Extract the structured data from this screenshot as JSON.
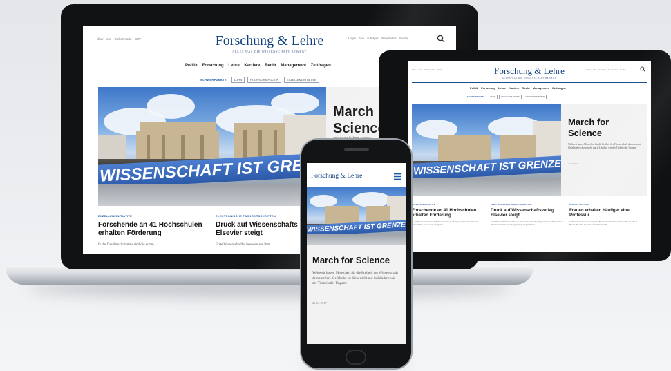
{
  "site": {
    "brand": "Forschung & Lehre",
    "tagline": "ALLES WAS DIE WISSENSCHAFT BEWEGT",
    "left_links": [
      "Über uns",
      "Stellenmarkt",
      "DHV"
    ],
    "right_links": [
      "Login",
      "Abo",
      "E-Paper",
      "Newsletter"
    ],
    "search_label": "Suche",
    "nav": [
      "Politik",
      "Forschung",
      "Lehre",
      "Karriere",
      "Recht",
      "Management",
      "Zeitfragen"
    ],
    "focus_label": "SCHWERPUNKTE",
    "focus_tags": [
      "LOHN",
      "HOCHSCHULPOLITIK",
      "EXZELLENZINITIATIVE"
    ],
    "phone_focus_tags": [
      "LOHN",
      "HOCHSCHULPOLITIK",
      "EXZELLENZINITIATIVE"
    ]
  },
  "hero": {
    "title": "March for Science",
    "title_line1": "March",
    "title_line2": "Science",
    "tablet_title_line1": "March for",
    "tablet_title_line2": "Science",
    "teaser_partial": "Weltweit haben Mensc",
    "teaser": "Weltweit haben Menschen für die Freiheit der Wissenschaft demonstriert. Gefährdet ist diese nicht nur in Ländern wie der Türkei oder Ungarn.",
    "date": "21.04.2017",
    "banner_text": "WISSENSCHAFT IST GRENZENLOS",
    "banner_text_cropped": "WISSENSCHAFT IST GRENZEN"
  },
  "articles": [
    {
      "kicker": "EXZELLENZINITIATIVE",
      "title": "Forschende an 41 Hochschulen erhalten Förderung",
      "teaser": "In der Exzellenzinitiative sind die ersten",
      "teaser_tablet": "In der Exzellenzinitiative sind die ersten Entscheidungen gefallen. Von allen die Universitäten haben neun erfolgreich."
    },
    {
      "kicker": "ELEKTRONISCHE FACHZEITSCHRIFTEN",
      "title": "Druck auf Wissenschaftsverlag Elsevier steigt",
      "title_cropped": "Druck auf Wissenschafts",
      "title_cropped2": "Elsevier steigt",
      "teaser": "Erste Wissenschaftler beenden aus Prot",
      "teaser_tablet": "Erste Wissenschaftler beenden aus Protest ihre Gutachtertätigkeit. Verhandlungen über Abonnements mit dem Verlag sind erneut gescheitert."
    },
    {
      "kicker": "GLEICHSTELLUNG",
      "title": "Frauen erhalten häufiger eine Professur",
      "teaser_tablet": "45 Prozent der Rufernennungen an Berliner Hochschulen gehen in diesem Jahr an Frauen. Das Ziel ist damit noch nicht erreicht."
    }
  ],
  "colors": {
    "brand": "#0f3f7e",
    "kicker": "#1a57a3",
    "banner": "#2c59a8"
  }
}
